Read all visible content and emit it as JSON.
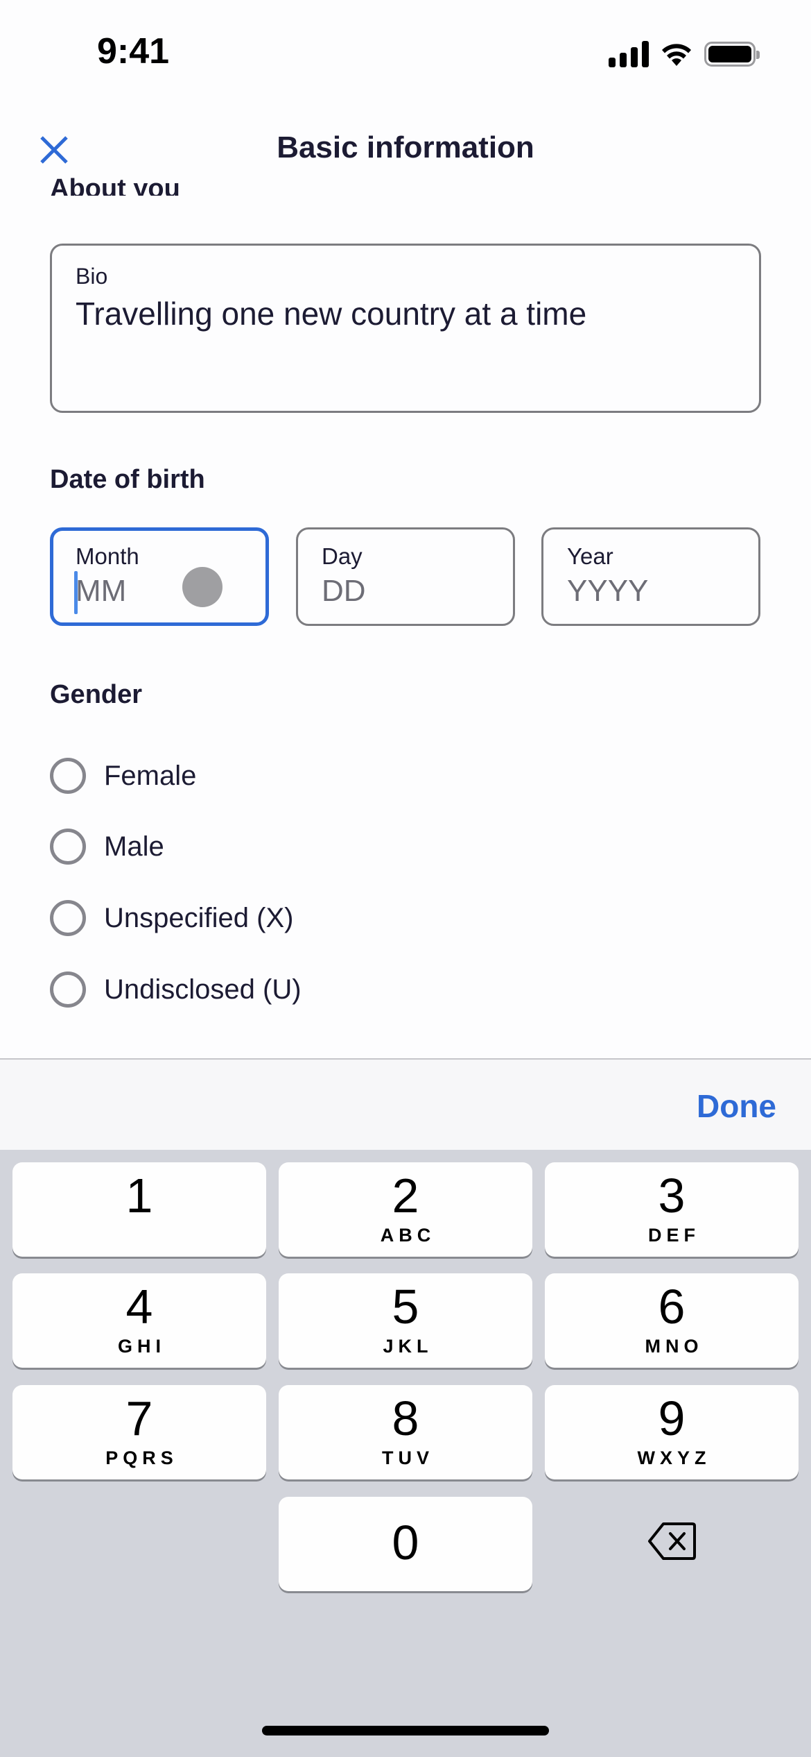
{
  "status_bar": {
    "time": "9:41"
  },
  "header": {
    "title": "Basic information",
    "close_icon": "close-icon"
  },
  "about": {
    "section_title": "About you",
    "bio": {
      "label": "Bio",
      "value": "Travelling one new country at a time"
    }
  },
  "dob": {
    "section_title": "Date of birth",
    "fields": [
      {
        "label": "Month",
        "placeholder": "MM",
        "value": "",
        "focused": true
      },
      {
        "label": "Day",
        "placeholder": "DD",
        "value": ""
      },
      {
        "label": "Year",
        "placeholder": "YYYY",
        "value": ""
      }
    ]
  },
  "gender": {
    "section_title": "Gender",
    "options": [
      {
        "label": "Female",
        "selected": false
      },
      {
        "label": "Male",
        "selected": false
      },
      {
        "label": "Unspecified (X)",
        "selected": false
      },
      {
        "label": "Undisclosed (U)",
        "selected": false
      }
    ]
  },
  "keyboard": {
    "done_label": "Done",
    "keys": [
      {
        "digit": "1",
        "letters": ""
      },
      {
        "digit": "2",
        "letters": "ABC"
      },
      {
        "digit": "3",
        "letters": "DEF"
      },
      {
        "digit": "4",
        "letters": "GHI"
      },
      {
        "digit": "5",
        "letters": "JKL"
      },
      {
        "digit": "6",
        "letters": "MNO"
      },
      {
        "digit": "7",
        "letters": "PQRS"
      },
      {
        "digit": "8",
        "letters": "TUV"
      },
      {
        "digit": "9",
        "letters": "WXYZ"
      },
      {
        "digit": "0",
        "letters": ""
      }
    ],
    "delete_icon": "backspace-icon"
  },
  "colors": {
    "accent": "#2e6ad6",
    "text": "#1c1b33",
    "border": "#7c7c80",
    "keyboard_bg": "#d2d4db"
  }
}
